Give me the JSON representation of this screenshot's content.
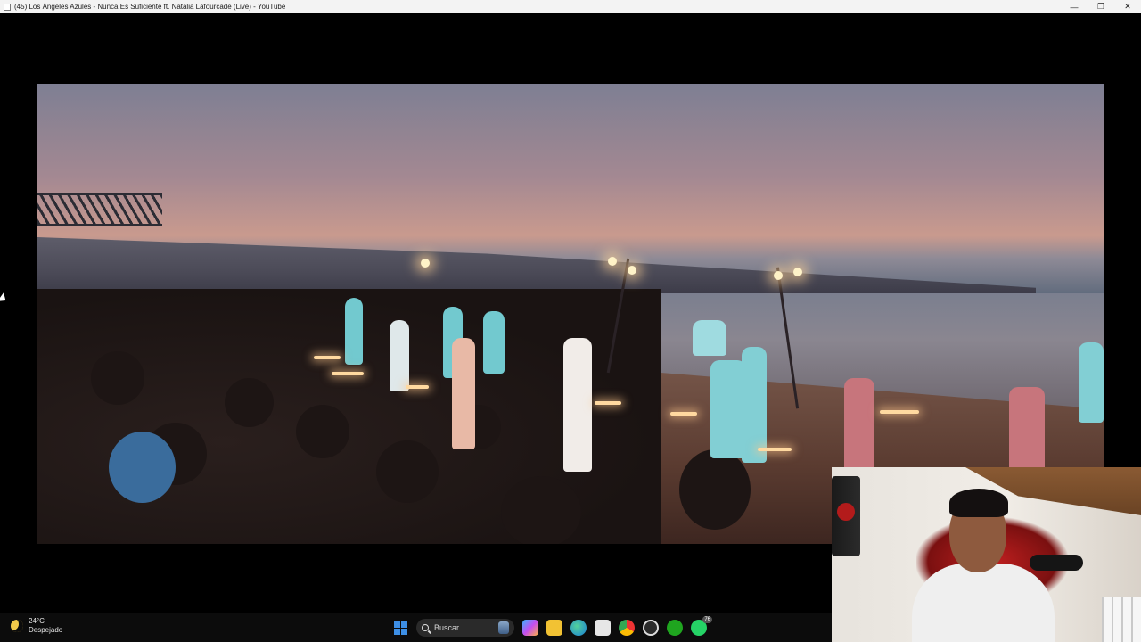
{
  "window": {
    "title": "(45) Los Ángeles Azules - Nunca Es Suficiente ft. Natalia Lafourcade (Live) - YouTube",
    "minimize_glyph": "—",
    "maximize_glyph": "❐",
    "close_glyph": "✕"
  },
  "taskbar": {
    "weather": {
      "temperature": "24°C",
      "condition": "Despejado",
      "icon": "moon-icon"
    },
    "search": {
      "label": "Buscar",
      "icon": "search-icon"
    },
    "apps": [
      {
        "name": "start",
        "icon": "windows-start-icon"
      },
      {
        "name": "copilot",
        "icon": "copilot-icon"
      },
      {
        "name": "file-explorer",
        "icon": "folder-icon"
      },
      {
        "name": "edge",
        "icon": "edge-icon"
      },
      {
        "name": "store",
        "icon": "store-icon"
      },
      {
        "name": "chrome",
        "icon": "chrome-icon"
      },
      {
        "name": "obs",
        "icon": "obs-icon"
      },
      {
        "name": "xbox",
        "icon": "xbox-icon"
      },
      {
        "name": "whatsapp",
        "icon": "whatsapp-icon",
        "badge": "76"
      }
    ]
  },
  "colors": {
    "titlebar_bg": "#f3f3f3",
    "taskbar_bg": "#0c0c0c",
    "windows_blue": "#3d8fe6",
    "whatsapp_green": "#25d366"
  }
}
